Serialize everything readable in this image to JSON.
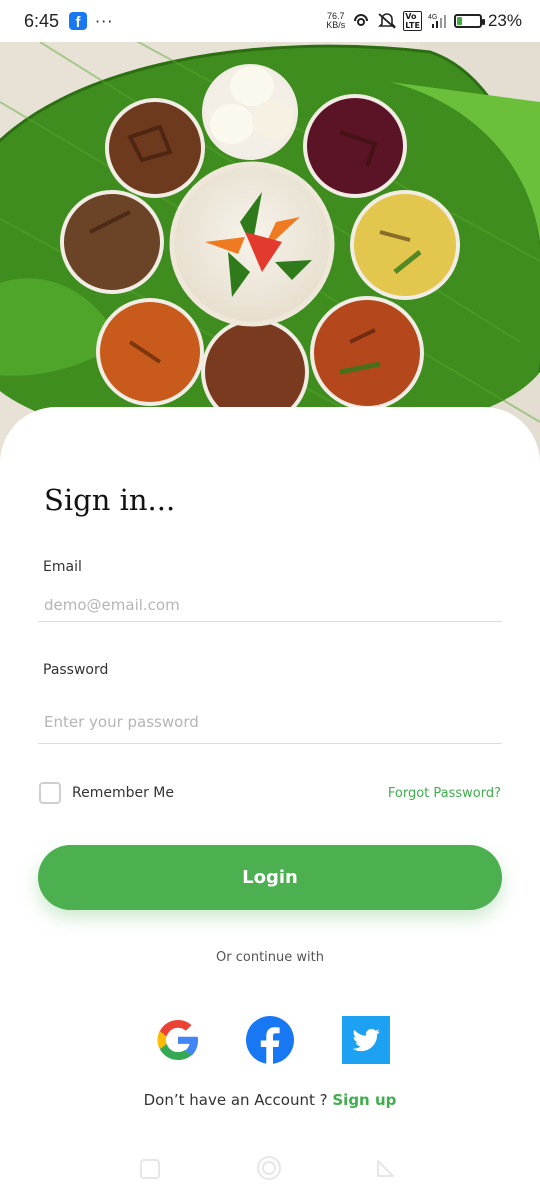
{
  "status_bar": {
    "time": "6:45",
    "more": "···",
    "speed_value": "76.7",
    "speed_unit": "KB/s",
    "network": "4G",
    "lte": "Vo LTE",
    "battery_percent": "23%",
    "battery_level": 0.23,
    "icons": [
      "facebook-icon",
      "hotspot-icon",
      "mute-icon",
      "volte-icon",
      "signal-icon",
      "battery-icon"
    ]
  },
  "signin": {
    "title": "Sign in...",
    "email_label": "Email",
    "email_placeholder": "demo@email.com",
    "password_label": "Password",
    "password_placeholder": "Enter your password",
    "remember_label": "Remember Me",
    "remember_checked": false,
    "forgot_label": "Forgot Password?",
    "login_label": "Login",
    "continue_label": "Or continue with",
    "social": [
      "google-icon",
      "facebook-icon",
      "twitter-icon"
    ],
    "no_account_text": "Don’t have an Account ?",
    "signup_label": "Sign up"
  },
  "colors": {
    "accent": "#4caf50",
    "link": "#3fae4d",
    "facebook": "#1877f2",
    "twitter": "#1da1f2"
  },
  "nav_bar": {
    "icons": [
      "recents-icon",
      "home-icon",
      "back-icon"
    ]
  }
}
